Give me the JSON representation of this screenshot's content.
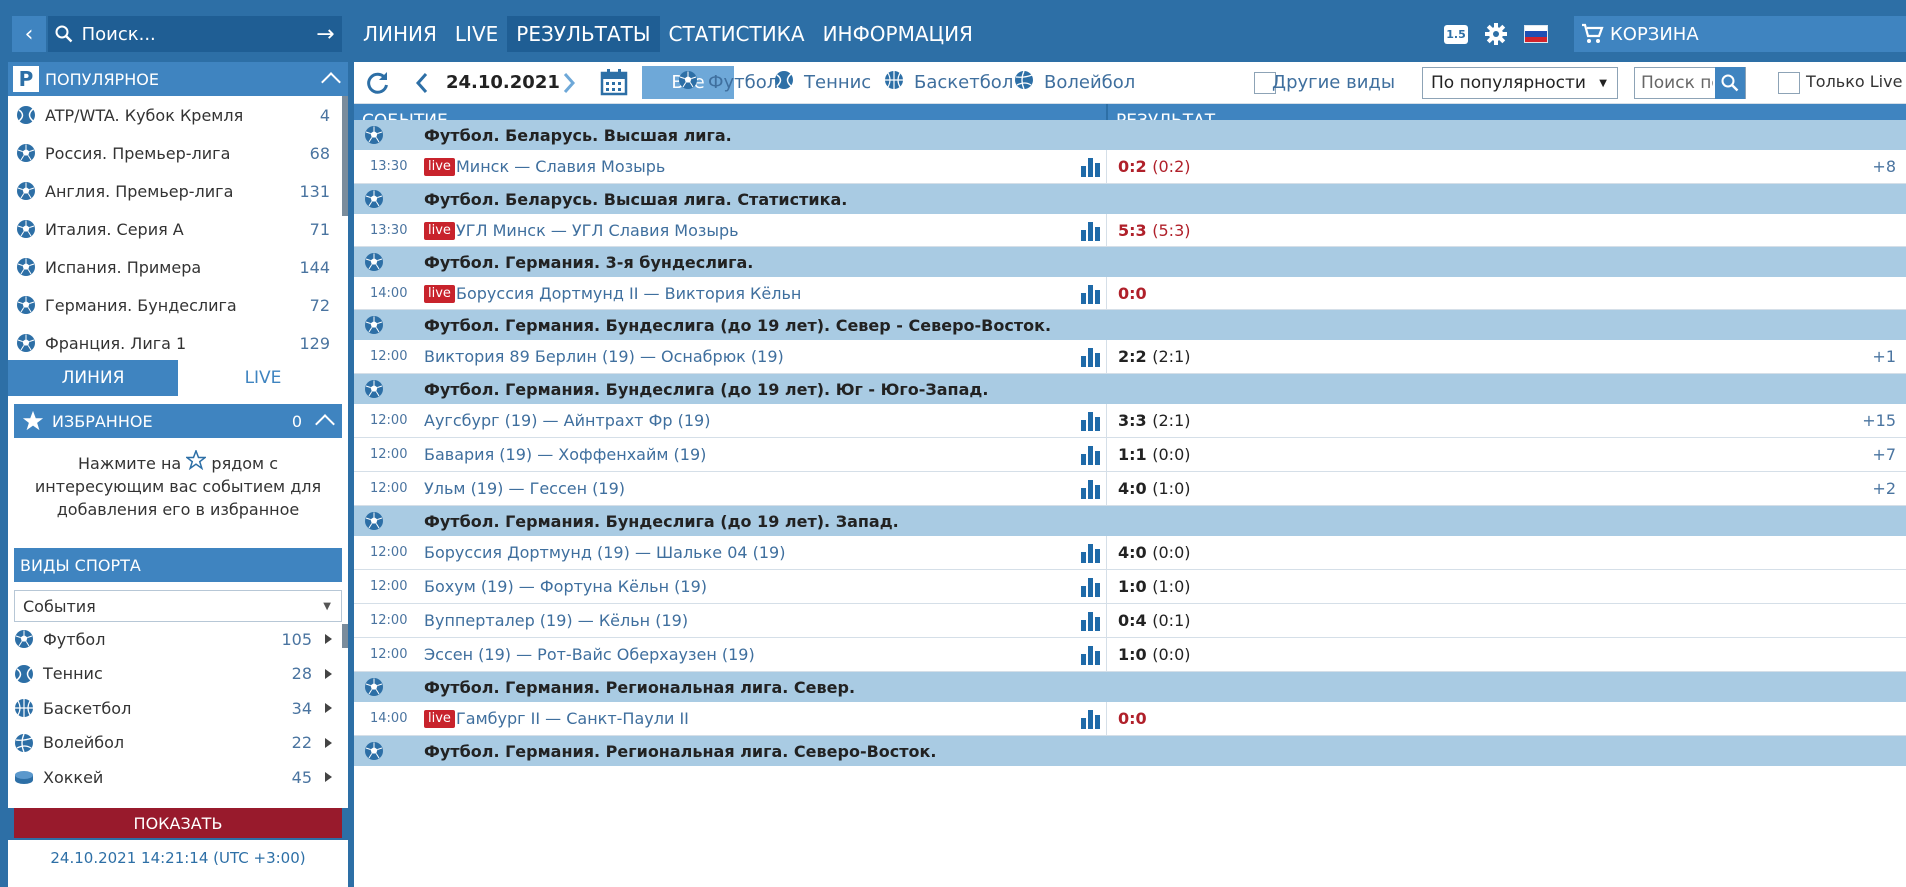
{
  "search": {
    "placeholder": "Поиск..."
  },
  "nav": {
    "items": [
      {
        "label": "ЛИНИЯ"
      },
      {
        "label": "LIVE"
      },
      {
        "label": "РЕЗУЛЬТАТЫ"
      },
      {
        "label": "СТАТИСТИКА"
      },
      {
        "label": "ИНФОРМАЦИЯ"
      }
    ],
    "active_index": 2,
    "version": "1.5",
    "cart_label": "КОРЗИНА"
  },
  "sidebar": {
    "popular_title": "ПОПУЛЯРНОЕ",
    "popular": [
      {
        "label": "ATP/WTA. Кубок Кремля",
        "count": "4",
        "icon": "tennis-ball-icon"
      },
      {
        "label": "Россия. Премьер-лига",
        "count": "68",
        "icon": "football-icon"
      },
      {
        "label": "Англия. Премьер-лига",
        "count": "131",
        "icon": "football-icon"
      },
      {
        "label": "Италия. Серия А",
        "count": "71",
        "icon": "football-icon"
      },
      {
        "label": "Испания. Примера",
        "count": "144",
        "icon": "football-icon"
      },
      {
        "label": "Германия. Бундеслига",
        "count": "72",
        "icon": "football-icon"
      },
      {
        "label": "Франция. Лига 1",
        "count": "129",
        "icon": "football-icon"
      }
    ],
    "tab_line": "ЛИНИЯ",
    "tab_live": "LIVE",
    "favorites_title": "ИЗБРАННОЕ",
    "favorites_count": "0",
    "fav_text_before": "Нажмите на",
    "fav_text_after": "рядом с интересующим вас событием для добавления его в избранное",
    "sports_title": "ВИДЫ СПОРТА",
    "sports_select": "События",
    "sports": [
      {
        "label": "Футбол",
        "count": "105",
        "icon": "football-icon"
      },
      {
        "label": "Теннис",
        "count": "28",
        "icon": "tennis-ball-icon"
      },
      {
        "label": "Баскетбол",
        "count": "34",
        "icon": "basketball-icon"
      },
      {
        "label": "Волейбол",
        "count": "22",
        "icon": "volleyball-icon"
      },
      {
        "label": "Хоккей",
        "count": "45",
        "icon": "hockey-puck-icon"
      }
    ],
    "show_button": "ПОКАЗАТЬ",
    "clock": "24.10.2021 14:21:14 (UTC +3:00)"
  },
  "filters": {
    "date": "24.10.2021",
    "all": "Все",
    "sports": [
      {
        "label": "Футбол",
        "icon": "football-icon"
      },
      {
        "label": "Теннис",
        "icon": "tennis-ball-icon"
      },
      {
        "label": "Баскетбол",
        "icon": "basketball-icon"
      },
      {
        "label": "Волейбол",
        "icon": "volleyball-icon"
      }
    ],
    "other_sports": "Другие виды",
    "sort": "По популярности",
    "search_placeholder": "Поиск по",
    "only_live": "Только Live"
  },
  "table": {
    "col_event": "СОБЫТИЕ",
    "col_result": "РЕЗУЛЬТАТ",
    "rows": [
      {
        "type": "league",
        "name": "Футбол. Беларусь. Высшая лига."
      },
      {
        "type": "match",
        "time": "13:30",
        "live": "live",
        "teams": "Минск — Славия Мозырь",
        "score": "0:2",
        "half": "(0:2)",
        "red": true,
        "more": "+8"
      },
      {
        "type": "league",
        "name": "Футбол. Беларусь. Высшая лига. Статистика."
      },
      {
        "type": "match",
        "time": "13:30",
        "live": "live",
        "teams": "УГЛ Минск — УГЛ Славия Мозырь",
        "score": "5:3",
        "half": "(5:3)",
        "red": true,
        "more": ""
      },
      {
        "type": "league",
        "name": "Футбол. Германия. 3-я бундеслига."
      },
      {
        "type": "match",
        "time": "14:00",
        "live": "live",
        "teams": "Боруссия Дортмунд II — Виктория Кёльн",
        "score": "0:0",
        "half": "",
        "red": true,
        "more": ""
      },
      {
        "type": "league",
        "name": "Футбол. Германия. Бундеслига (до 19 лет). Север - Северо-Восток."
      },
      {
        "type": "match",
        "time": "12:00",
        "live": "",
        "teams": "Виктория 89 Берлин (19) — Оснабрюк (19)",
        "score": "2:2",
        "half": "(2:1)",
        "red": false,
        "more": "+1"
      },
      {
        "type": "league",
        "name": "Футбол. Германия. Бундеслига (до 19 лет). Юг - Юго-Запад."
      },
      {
        "type": "match",
        "time": "12:00",
        "live": "",
        "teams": "Аугсбург (19) — Айнтрахт Фр (19)",
        "score": "3:3",
        "half": "(2:1)",
        "red": false,
        "more": "+15"
      },
      {
        "type": "match",
        "time": "12:00",
        "live": "",
        "teams": "Бавария (19) — Хоффенхайм (19)",
        "score": "1:1",
        "half": "(0:0)",
        "red": false,
        "more": "+7"
      },
      {
        "type": "match",
        "time": "12:00",
        "live": "",
        "teams": "Ульм (19) — Гессен (19)",
        "score": "4:0",
        "half": "(1:0)",
        "red": false,
        "more": "+2"
      },
      {
        "type": "league",
        "name": "Футбол. Германия. Бундеслига (до 19 лет). Запад."
      },
      {
        "type": "match",
        "time": "12:00",
        "live": "",
        "teams": "Боруссия Дортмунд (19) — Шальке 04 (19)",
        "score": "4:0",
        "half": "(0:0)",
        "red": false,
        "more": ""
      },
      {
        "type": "match",
        "time": "12:00",
        "live": "",
        "teams": "Бохум (19) — Фортуна Кёльн (19)",
        "score": "1:0",
        "half": "(1:0)",
        "red": false,
        "more": ""
      },
      {
        "type": "match",
        "time": "12:00",
        "live": "",
        "teams": "Вупперталер (19) — Кёльн (19)",
        "score": "0:4",
        "half": "(0:1)",
        "red": false,
        "more": ""
      },
      {
        "type": "match",
        "time": "12:00",
        "live": "",
        "teams": "Эссен (19) — Рот-Вайс Оберхаузен (19)",
        "score": "1:0",
        "half": "(0:0)",
        "red": false,
        "more": ""
      },
      {
        "type": "league",
        "name": "Футбол. Германия. Региональная лига. Север."
      },
      {
        "type": "match",
        "time": "14:00",
        "live": "live",
        "teams": "Гамбург II — Санкт-Паули II",
        "score": "0:0",
        "half": "",
        "red": true,
        "more": ""
      },
      {
        "type": "league",
        "name": "Футбол. Германия. Региональная лига. Северо-Восток."
      }
    ]
  },
  "colors": {
    "brand_blue": "#2d6fa6",
    "header_blue": "#3f84c0",
    "league_row": "#a9cbe3",
    "live_red": "#c8232c",
    "show_button": "#981a2c"
  }
}
